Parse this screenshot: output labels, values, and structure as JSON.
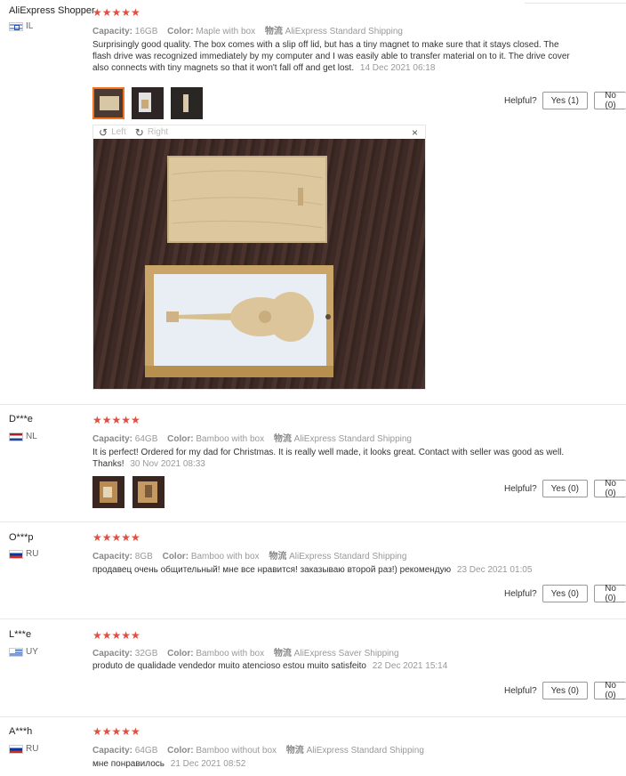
{
  "helpful_label": "Helpful?",
  "viewer": {
    "left": "Left",
    "right": "Right",
    "close": "×"
  },
  "reviews": [
    {
      "user": "AliExpress Shopper",
      "country": "IL",
      "stars": "★★★★★",
      "capacity_label": "Capacity:",
      "capacity": "16GB",
      "color_label": "Color:",
      "color": "Maple with box",
      "shipping_label": "物流",
      "shipping": "AliExpress Standard Shipping",
      "text": "Surprisingly good quality. The box comes with a slip off lid, but has a tiny magnet to make sure that it stays closed. The flash drive was recognized immediately by my computer and I was easily able to transfer material on to it. The drive cover also connects with tiny magnets so that it won't fall off and get lost.",
      "date": "14 Dec 2021 06:18",
      "yes": "Yes (1)",
      "no": "No (0)"
    },
    {
      "user": "D***e",
      "country": "NL",
      "stars": "★★★★★",
      "capacity_label": "Capacity:",
      "capacity": "64GB",
      "color_label": "Color:",
      "color": "Bamboo with box",
      "shipping_label": "物流",
      "shipping": "AliExpress Standard Shipping",
      "text": "It is perfect! Ordered for my dad for Christmas. It is really well made, it looks great. Contact with seller was good as well. Thanks!",
      "date": "30 Nov 2021 08:33",
      "yes": "Yes (0)",
      "no": "No (0)"
    },
    {
      "user": "O***p",
      "country": "RU",
      "stars": "★★★★★",
      "capacity_label": "Capacity:",
      "capacity": "8GB",
      "color_label": "Color:",
      "color": "Bamboo with box",
      "shipping_label": "物流",
      "shipping": "AliExpress Standard Shipping",
      "text": "продавец очень общительный! мне все нравится! заказываю второй раз!) рекомендую",
      "date": "23 Dec 2021 01:05",
      "yes": "Yes (0)",
      "no": "No (0)"
    },
    {
      "user": "L***e",
      "country": "UY",
      "stars": "★★★★★",
      "capacity_label": "Capacity:",
      "capacity": "32GB",
      "color_label": "Color:",
      "color": "Bamboo with box",
      "shipping_label": "物流",
      "shipping": "AliExpress Saver Shipping",
      "text": "produto de qualidade vendedor muito atencioso estou muito satisfeito",
      "date": "22 Dec 2021 15:14",
      "yes": "Yes (0)",
      "no": "No (0)"
    },
    {
      "user": "A***h",
      "country": "RU",
      "stars": "★★★★★",
      "capacity_label": "Capacity:",
      "capacity": "64GB",
      "color_label": "Color:",
      "color": "Bamboo without box",
      "shipping_label": "物流",
      "shipping": "AliExpress Standard Shipping",
      "text": "мне понравилось",
      "date": "21 Dec 2021 08:52"
    }
  ]
}
